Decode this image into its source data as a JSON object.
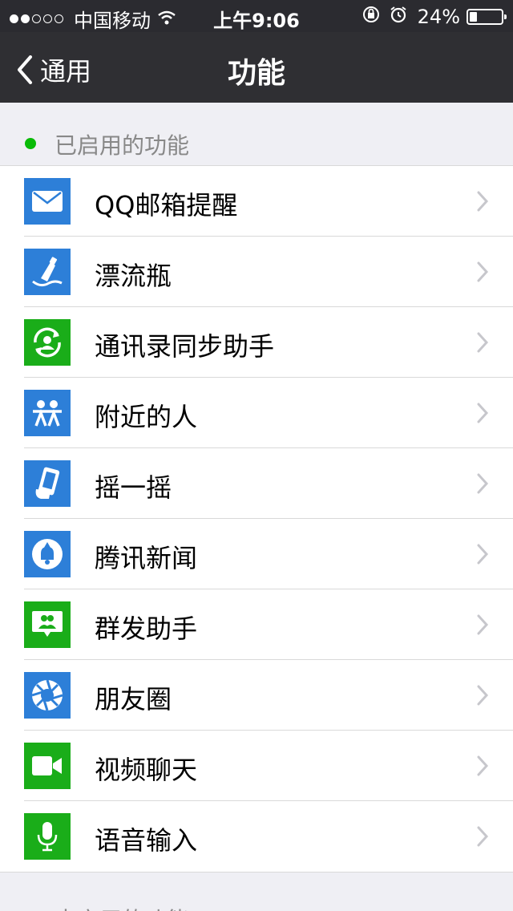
{
  "status_bar": {
    "signal": "●●○○○",
    "carrier": "中国移动",
    "time": "上午9:06",
    "battery": "24%",
    "battery_level": 0.24
  },
  "nav": {
    "back_label": "通用",
    "title": "功能"
  },
  "enabled_section": {
    "title": "已启用的功能"
  },
  "disabled_section": {
    "title": "未启用的功能"
  },
  "colors": {
    "blue_icon": "#2d7fd8",
    "green_icon": "#1aad19",
    "enabled_dot": "#09bb07"
  },
  "features": [
    {
      "label": "QQ邮箱提醒",
      "icon": "mail-icon",
      "color": "#2d7fd8"
    },
    {
      "label": "漂流瓶",
      "icon": "bottle-icon",
      "color": "#2d7fd8"
    },
    {
      "label": "通讯录同步助手",
      "icon": "contact-sync-icon",
      "color": "#1aad19"
    },
    {
      "label": "附近的人",
      "icon": "people-nearby-icon",
      "color": "#2d7fd8"
    },
    {
      "label": "摇一摇",
      "icon": "shake-icon",
      "color": "#2d7fd8"
    },
    {
      "label": "腾讯新闻",
      "icon": "news-icon",
      "color": "#2d7fd8"
    },
    {
      "label": "群发助手",
      "icon": "broadcast-icon",
      "color": "#1aad19"
    },
    {
      "label": "朋友圈",
      "icon": "moments-icon",
      "color": "#2d7fd8"
    },
    {
      "label": "视频聊天",
      "icon": "video-icon",
      "color": "#1aad19"
    },
    {
      "label": "语音输入",
      "icon": "microphone-icon",
      "color": "#1aad19"
    }
  ]
}
